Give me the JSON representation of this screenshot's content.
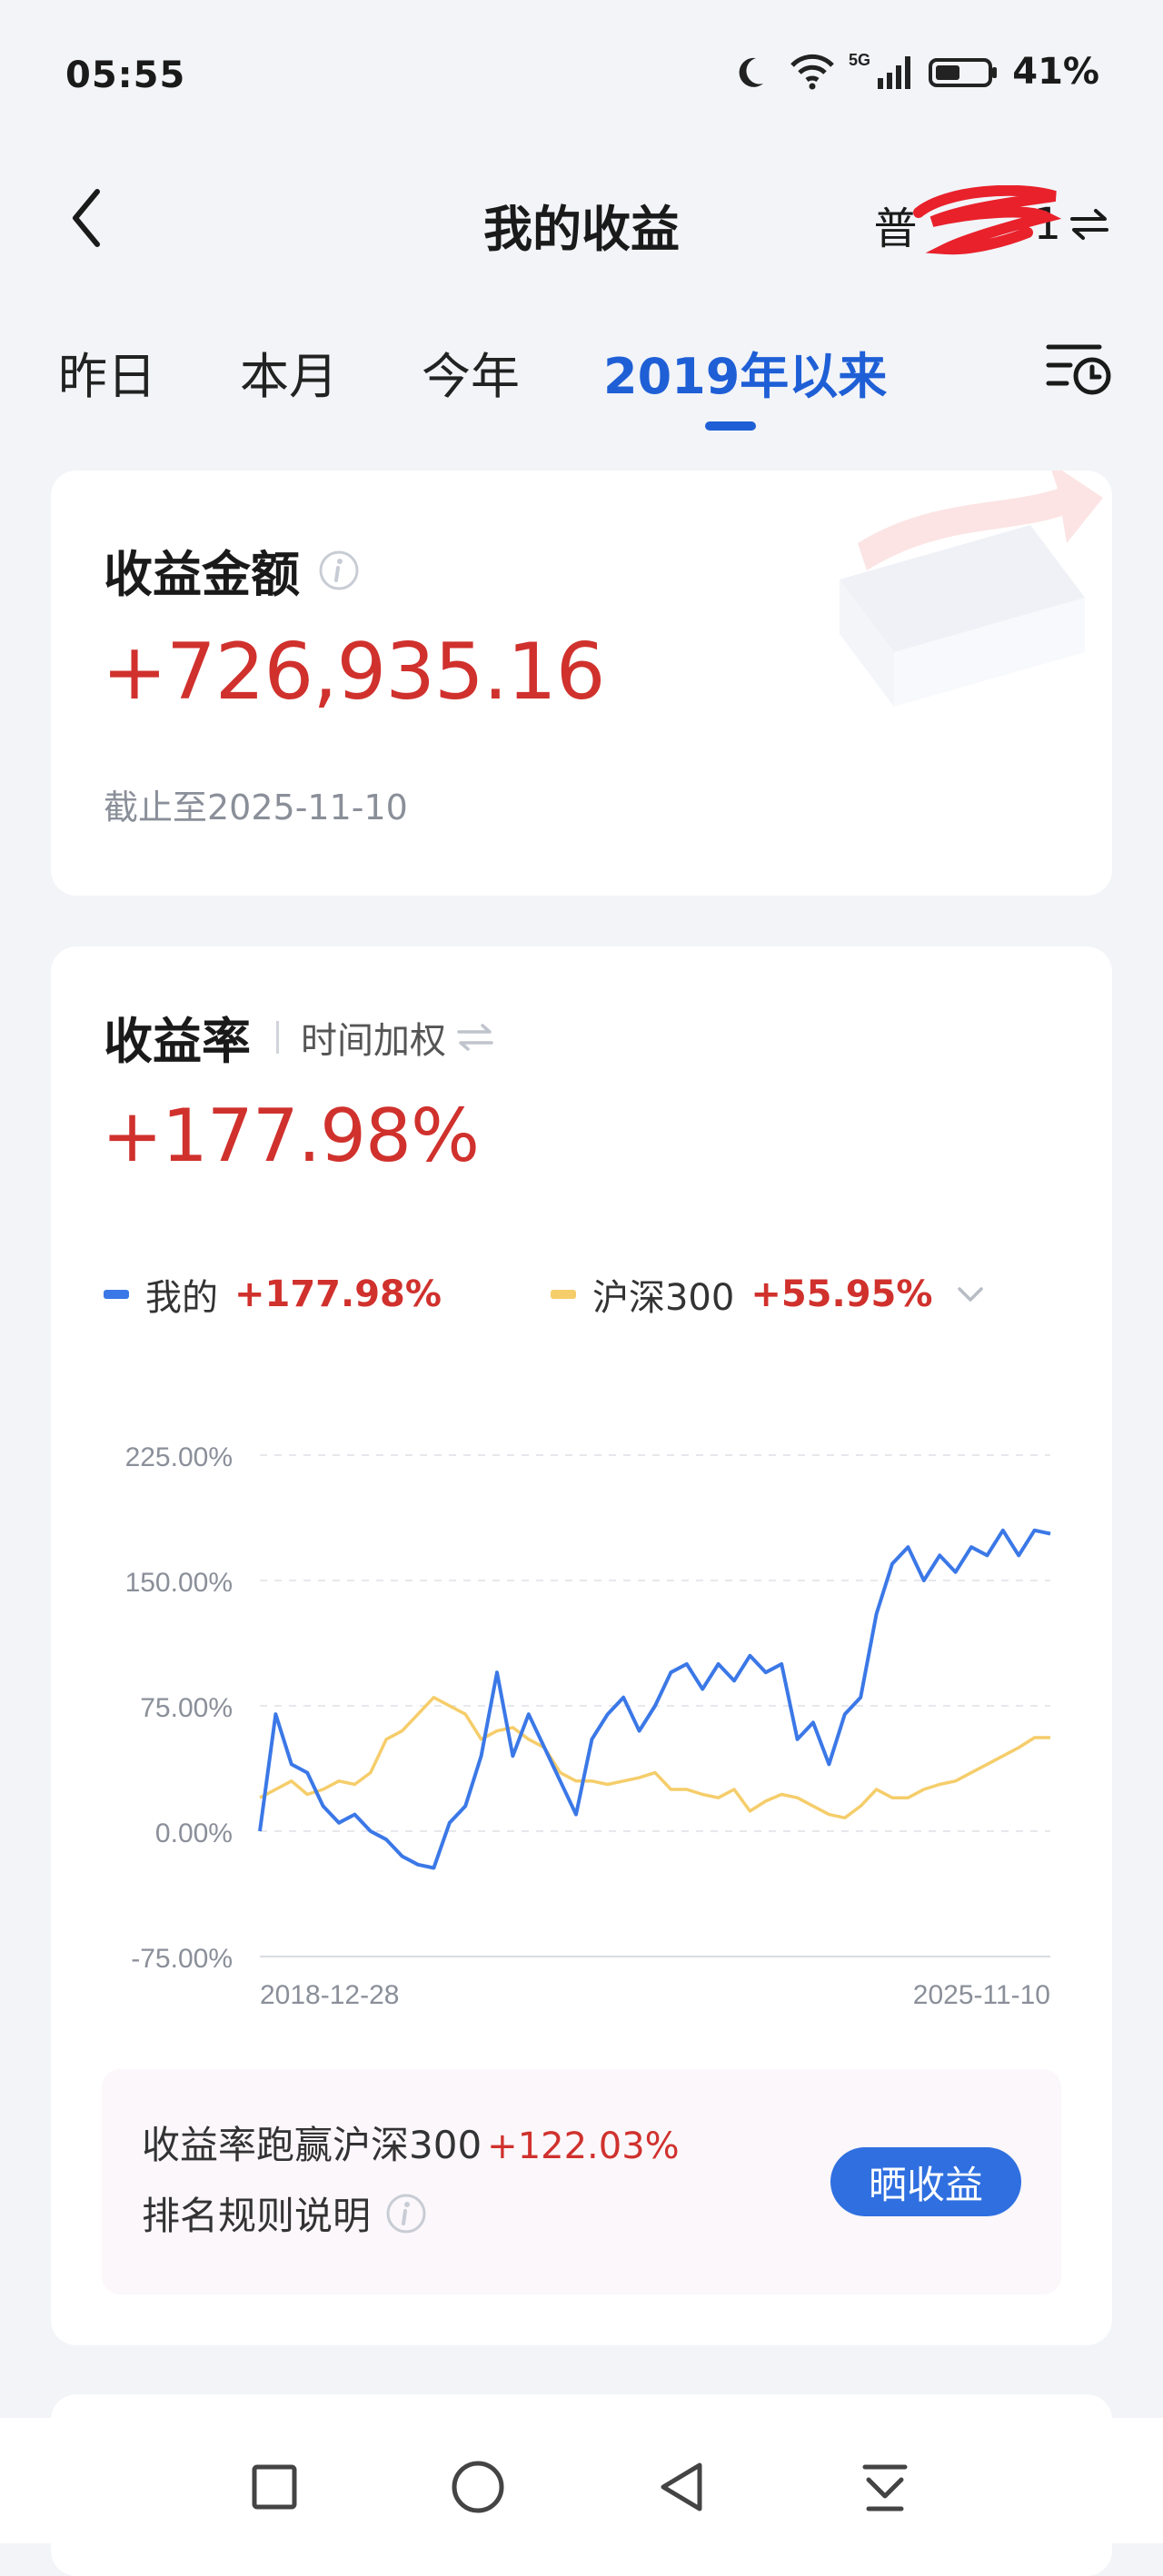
{
  "status": {
    "time": "05:55",
    "network": "5G",
    "battery": "41%"
  },
  "header": {
    "title": "我的收益",
    "account_visible": "普",
    "account_tail": "1"
  },
  "tabs": [
    {
      "label": "昨日"
    },
    {
      "label": "本月"
    },
    {
      "label": "今年"
    },
    {
      "label": "2019年以来",
      "active": true
    }
  ],
  "earnings": {
    "label": "收益金额",
    "amount": "+726,935.16",
    "as_of": "截止至2025-11-10"
  },
  "rate": {
    "label": "收益率",
    "mode": "时间加权",
    "value": "+177.98%",
    "legend": [
      {
        "name": "我的",
        "value": "+177.98%",
        "color": "#3b78e7"
      },
      {
        "name": "沪深300",
        "value": "+55.95%",
        "color": "#f5cd6a"
      }
    ]
  },
  "chart_data": {
    "type": "line",
    "yticks": [
      "225.00%",
      "150.00%",
      "75.00%",
      "0.00%",
      "-75.00%"
    ],
    "ylim": [
      -75,
      225
    ],
    "x_start_label": "2018-12-28",
    "x_end_label": "2025-11-10",
    "x": [
      0,
      0.02,
      0.04,
      0.06,
      0.08,
      0.1,
      0.12,
      0.14,
      0.16,
      0.18,
      0.2,
      0.22,
      0.24,
      0.26,
      0.28,
      0.3,
      0.32,
      0.34,
      0.36,
      0.38,
      0.4,
      0.42,
      0.44,
      0.46,
      0.48,
      0.5,
      0.52,
      0.54,
      0.56,
      0.58,
      0.6,
      0.62,
      0.64,
      0.66,
      0.68,
      0.7,
      0.72,
      0.74,
      0.76,
      0.78,
      0.8,
      0.82,
      0.84,
      0.86,
      0.88,
      0.9,
      0.92,
      0.94,
      0.96,
      0.98,
      1.0
    ],
    "series": [
      {
        "name": "我的",
        "color": "#3b78e7",
        "values": [
          0,
          70,
          40,
          35,
          15,
          5,
          10,
          0,
          -5,
          -15,
          -20,
          -22,
          5,
          15,
          45,
          95,
          45,
          70,
          50,
          30,
          10,
          55,
          70,
          80,
          60,
          75,
          95,
          100,
          85,
          100,
          90,
          105,
          95,
          100,
          55,
          65,
          40,
          70,
          80,
          130,
          160,
          170,
          150,
          165,
          155,
          170,
          165,
          180,
          165,
          180,
          178
        ]
      },
      {
        "name": "沪深300",
        "color": "#f5cd6a",
        "values": [
          20,
          25,
          30,
          22,
          25,
          30,
          28,
          35,
          55,
          60,
          70,
          80,
          75,
          70,
          55,
          60,
          62,
          55,
          50,
          35,
          30,
          30,
          28,
          30,
          32,
          35,
          25,
          25,
          22,
          20,
          25,
          12,
          18,
          22,
          20,
          15,
          10,
          8,
          15,
          25,
          20,
          20,
          25,
          28,
          30,
          35,
          40,
          45,
          50,
          56,
          56
        ]
      }
    ]
  },
  "compare": {
    "text": "收益率跑赢沪深300",
    "value": "+122.03%",
    "rules_label": "排名规则说明",
    "share_label": "晒收益"
  },
  "icons": {
    "back": "back-arrow-icon",
    "swap": "swap-arrows-icon",
    "filter": "history-filter-icon",
    "info": "info-icon",
    "chevron": "chevron-down-icon"
  }
}
